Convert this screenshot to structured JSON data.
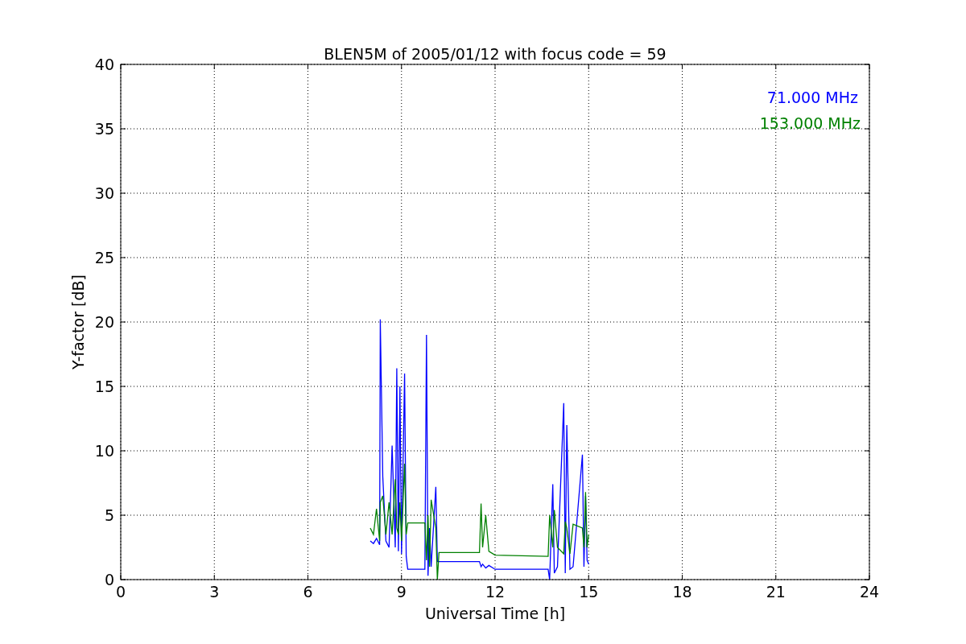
{
  "figure": {
    "chart_data": {
      "type": "line",
      "title": "BLEN5M of 2005/01/12 with focus code = 59",
      "xlabel": "Universal Time [h]",
      "ylabel": "Y-factor [dB]",
      "xlim": [
        0,
        24
      ],
      "ylim": [
        0,
        40
      ],
      "xticks": [
        0,
        3,
        6,
        9,
        12,
        15,
        18,
        21,
        24
      ],
      "yticks": [
        0,
        5,
        10,
        15,
        20,
        25,
        30,
        35,
        40
      ],
      "grid": true,
      "x": [
        8.0,
        8.1,
        8.2,
        8.3,
        8.32,
        8.4,
        8.5,
        8.6,
        8.7,
        8.8,
        8.85,
        8.9,
        8.95,
        9.0,
        9.1,
        9.15,
        9.2,
        9.75,
        9.8,
        9.85,
        9.9,
        9.95,
        10.1,
        10.15,
        10.2,
        11.5,
        11.55,
        11.6,
        11.7,
        11.8,
        12.0,
        13.7,
        13.75,
        13.85,
        13.9,
        14.0,
        14.2,
        14.25,
        14.3,
        14.4,
        14.5,
        14.8,
        14.85,
        14.9,
        14.95,
        15.0
      ],
      "series": [
        {
          "name": "71.000 MHz",
          "color": "#0000ff",
          "values": [
            3,
            2.8,
            3.2,
            2.7,
            20.2,
            8,
            3,
            2.5,
            10.4,
            2.5,
            16.4,
            2.2,
            15,
            2,
            16,
            1.8,
            0.8,
            0.8,
            19,
            0.3,
            4,
            1,
            7.2,
            1.4,
            1.4,
            1.4,
            1,
            1.2,
            0.9,
            1.1,
            0.8,
            0.8,
            0,
            7.4,
            0.5,
            1,
            13.7,
            0.5,
            12,
            0.8,
            1,
            9.7,
            1,
            6.5,
            1.5,
            1.2
          ]
        },
        {
          "name": "153.000 MHz",
          "color": "#008000",
          "values": [
            4,
            3.5,
            5.5,
            3,
            6,
            6.5,
            3.5,
            6,
            3.5,
            7.8,
            4,
            3.5,
            6,
            3,
            9,
            3.5,
            4.4,
            4.4,
            1.5,
            5,
            1,
            6.2,
            4,
            0,
            2.1,
            2.1,
            5.9,
            2.5,
            5,
            2.2,
            1.9,
            1.8,
            5,
            2.5,
            5.4,
            2.5,
            2,
            4.5,
            4,
            2,
            4.3,
            4,
            2.5,
            6.8,
            2.5,
            3.5
          ]
        }
      ]
    }
  }
}
